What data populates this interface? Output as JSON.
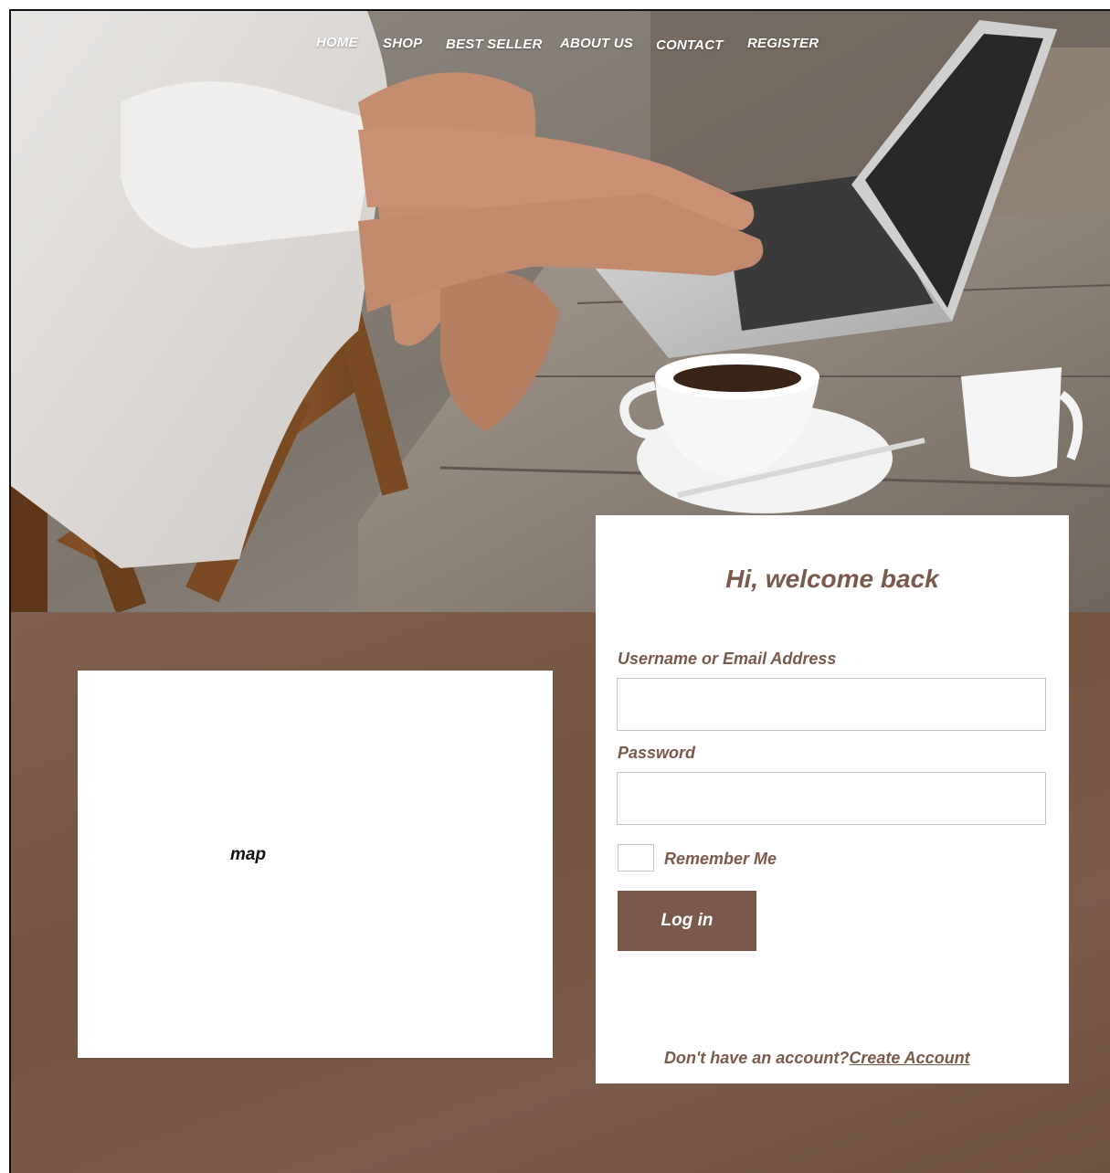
{
  "nav": {
    "home": "HOME",
    "shop": "SHOP",
    "best_seller": "BEST SELLER",
    "about_us": "ABOUT US",
    "contact": "CONTACT",
    "register": "REGISTER"
  },
  "map": {
    "label": "map"
  },
  "login": {
    "title": "Hi, welcome back",
    "username_label": "Username or Email Address",
    "username_value": "",
    "password_label": "Password",
    "password_value": "",
    "remember_label": "Remember Me",
    "remember_checked": false,
    "login_button": "Log in",
    "no_account_text": "Don't have an account?",
    "create_account_link": "Create Account"
  },
  "colors": {
    "brand_brown": "#7a5a4c",
    "card_bg": "#ffffff",
    "nav_text": "#ffffff"
  }
}
